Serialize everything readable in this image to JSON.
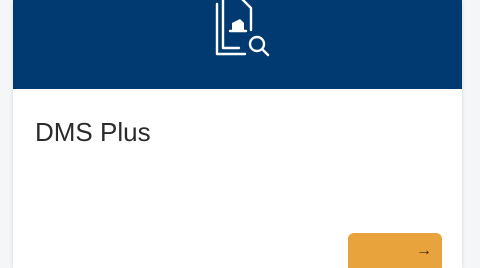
{
  "card": {
    "title": "DMS Plus",
    "header_icon": "document-search-icon",
    "action_icon": "arrow-right-icon",
    "arrow_glyph": "→"
  },
  "colors": {
    "header_bg": "#003a70",
    "accent": "#e8a33d",
    "card_bg": "#ffffff"
  }
}
